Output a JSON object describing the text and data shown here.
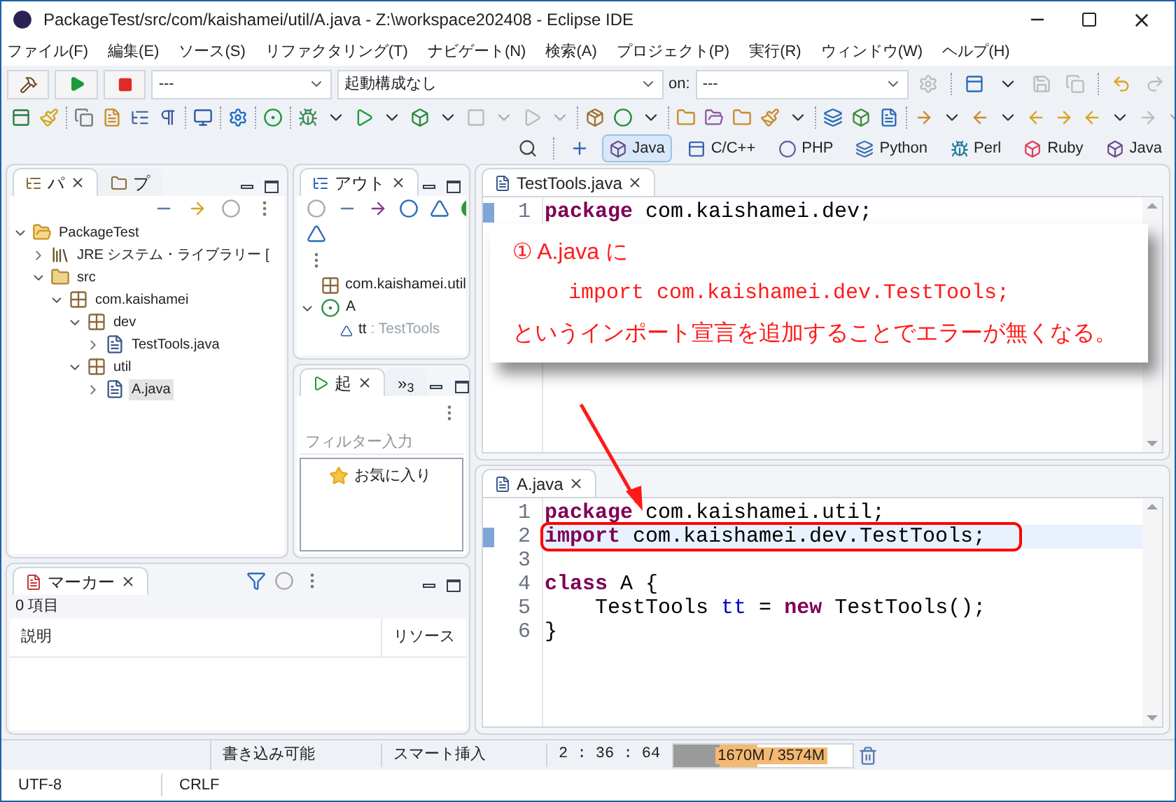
{
  "window": {
    "title": "PackageTest/src/com/kaishamei/util/A.java - Z:\\workspace202408 - Eclipse IDE"
  },
  "menu": [
    "ファイル(F)",
    "編集(E)",
    "ソース(S)",
    "リファクタリング(T)",
    "ナビゲート(N)",
    "検索(A)",
    "プロジェクト(P)",
    "実行(R)",
    "ウィンドウ(W)",
    "ヘルプ(H)"
  ],
  "toolbar": {
    "mode_select": {
      "value": "---"
    },
    "launch_select": {
      "value": "起動構成なし"
    },
    "target_label": "on:",
    "target_select": {
      "value": "---"
    }
  },
  "perspectives": [
    {
      "label": "Java",
      "selected": true
    },
    {
      "label": "C/C++",
      "selected": false
    },
    {
      "label": "PHP",
      "selected": false
    },
    {
      "label": "Python",
      "selected": false
    },
    {
      "label": "Perl",
      "selected": false
    },
    {
      "label": "Ruby",
      "selected": false
    },
    {
      "label": "Java",
      "selected": false
    }
  ],
  "package_explorer": {
    "tabs": [
      {
        "label": "パ",
        "selected": true
      },
      {
        "label": "プ",
        "selected": false
      }
    ],
    "tree": [
      {
        "label": "PackageTest",
        "kind": "project",
        "expanded": true,
        "selected": false,
        "children": [
          {
            "label": "JRE システム・ライブラリー [",
            "kind": "library",
            "expanded": false,
            "selected": false
          },
          {
            "label": "src",
            "kind": "folder",
            "expanded": true,
            "selected": false,
            "children": [
              {
                "label": "com.kaishamei",
                "kind": "package",
                "expanded": true,
                "selected": false,
                "children": [
                  {
                    "label": "dev",
                    "kind": "package",
                    "expanded": true,
                    "selected": false,
                    "children": [
                      {
                        "label": "TestTools.java",
                        "kind": "file",
                        "expanded": false,
                        "selected": false
                      }
                    ]
                  },
                  {
                    "label": "util",
                    "kind": "package",
                    "expanded": true,
                    "selected": false,
                    "children": [
                      {
                        "label": "A.java",
                        "kind": "file",
                        "expanded": false,
                        "selected": true
                      }
                    ]
                  }
                ]
              }
            ]
          }
        ]
      }
    ]
  },
  "outline": {
    "tab": "アウト",
    "items": [
      {
        "name": "com.kaishamei.util",
        "kind": "package"
      },
      {
        "name": "A",
        "kind": "class",
        "expanded": true,
        "children": [
          {
            "name": "tt",
            "type": " : TestTools",
            "kind": "field"
          }
        ]
      }
    ]
  },
  "launch_view": {
    "tabs": [
      {
        "label": "起",
        "selected": true
      },
      {
        "label": "»$_{3}$",
        "selected": false
      }
    ],
    "filter": {
      "placeholder": "フィルター入力"
    },
    "items": [
      "お気に入り"
    ]
  },
  "markers": {
    "tab": "マーカー",
    "count": "0 項目",
    "columns": [
      "説明",
      "リソース"
    ]
  },
  "editors": [
    {
      "tab": "TestTools.java",
      "lines": [
        {
          "number": "1",
          "current": false,
          "marker": true,
          "tokens": [
            {
              "kind": "keyword",
              "text": "package"
            },
            {
              "kind": "plain",
              "text": " com.kaishamei.dev;"
            }
          ]
        }
      ]
    },
    {
      "tab": "A.java",
      "lines": [
        {
          "number": "1",
          "current": false,
          "tokens": [
            {
              "kind": "keyword",
              "text": "package"
            },
            {
              "kind": "plain",
              "text": " com.kaishamei.util;"
            }
          ]
        },
        {
          "number": "2",
          "current": true,
          "marker": true,
          "annotated": true,
          "tokens": [
            {
              "kind": "keyword",
              "text": "import"
            },
            {
              "kind": "plain",
              "text": " com.kaishamei.dev.TestTools;"
            }
          ]
        },
        {
          "number": "3",
          "current": false
        },
        {
          "number": "4",
          "current": false,
          "tokens": [
            {
              "kind": "keyword",
              "text": "class"
            },
            {
              "kind": "plain",
              "text": " A {"
            }
          ]
        },
        {
          "number": "5",
          "current": false,
          "tokens": [
            {
              "kind": "plain",
              "text": "    TestTools "
            },
            {
              "kind": "field",
              "text": "tt"
            },
            {
              "kind": "plain",
              "text": " = "
            },
            {
              "kind": "keyword",
              "text": "new"
            },
            {
              "kind": "plain",
              "text": " TestTools();"
            }
          ]
        },
        {
          "number": "6",
          "current": false,
          "tokens": [
            {
              "kind": "plain",
              "text": "}"
            }
          ]
        }
      ]
    }
  ],
  "callout": {
    "lines": [
      "① A.java に",
      "import com.kaishamei.dev.TestTools;",
      "というインポート宣言を追加することでエラーが無くなる。"
    ]
  },
  "status_bar": {
    "write_mode": "書き込み可能",
    "insert_mode": "スマート挿入",
    "position": "2 : 36 : 64",
    "heap": {
      "text": "1670M / 3574M",
      "level": 0.47
    },
    "encoding": "UTF-8",
    "line_delimiter": "CRLF"
  }
}
